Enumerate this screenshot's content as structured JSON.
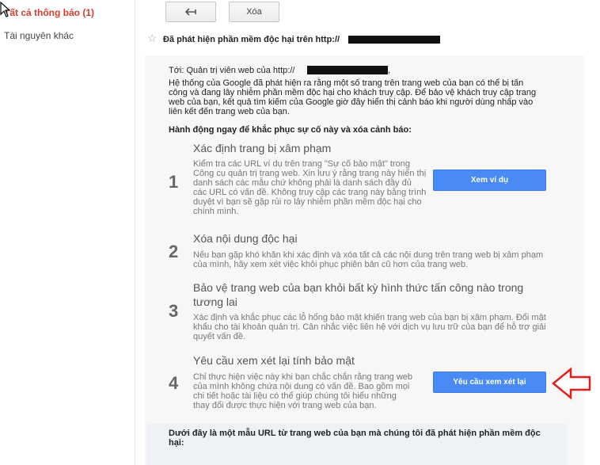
{
  "sidebar": {
    "items": [
      {
        "label": "Tất cả thông báo (1)"
      },
      {
        "label": "Tài nguyên khác"
      }
    ]
  },
  "toolbar": {
    "back_icon": "back-arrow-icon",
    "delete_label": "Xóa"
  },
  "message": {
    "subject": "Đã phát hiện phần mềm độc hại trên http://",
    "to_line": "Tới: Quản trị viên web của http://",
    "to_suffix": ",",
    "intro": "Hệ thống của Google đã phát hiện ra rằng một số trang trên trang web của bạn có thể bị tấn công và đang lây nhiễm phần mềm độc hại cho khách truy cập. Để bảo vệ khách truy cập trang web của bạn, kết quả tìm kiếm của Google giờ đây hiển thị cảnh báo khi người dùng nhấp vào liên kết đến trang web của bạn.",
    "action_heading": "Hành động ngay để khắc phục sự cố này và xóa cảnh báo:",
    "steps": [
      {
        "number": "1",
        "title": "Xác định trang bị xâm phạm",
        "description": "Kiểm tra các URL ví dụ trên trang \"Sự cố bảo mật\" trong Công cụ quản trị trang web. Xin lưu ý rằng trang này hiển thị danh sách các mẫu chứ không phải là danh sách đầy đủ các URL có vấn đề. Không truy cập các trang này bằng trình duyệt vì bạn sẽ gặp rủi ro lây nhiễm phần mềm độc hại cho chính mình.",
        "button": "Xem ví dụ"
      },
      {
        "number": "2",
        "title": "Xóa nội dung độc hại",
        "description": "Nếu bạn gặp khó khăn khi xác định và xóa tất cả các nội dung trên trang web bị xâm phạm của mình, hãy xem xét việc khôi phục phiên bản cũ hơn của trang web."
      },
      {
        "number": "3",
        "title": "Bảo vệ trang web của bạn khỏi bất kỳ hình thức tấn công nào trong tương lai",
        "description": "Xác định và khắc phục các lỗ hổng bảo mật khiến trang web của bạn bị xâm phạm. Đổi mật khẩu cho tài khoản quản trị. Cân nhắc việc liên hệ với dịch vụ lưu trữ của bạn để hỗ trợ giải quyết vấn đề."
      },
      {
        "number": "4",
        "title": "Yêu cầu xem xét lại tính bảo mật",
        "description": "Chỉ thực hiện việc này khi bạn chắc chắn rằng trang web của mình không chứa nội dung có vấn đề. Bao gồm mọi chi tiết hoặc tài liệu có thể giúp chúng tôi hiểu những thay đổi được thực hiện với trang web của bạn.",
        "button": "Yêu cầu xem xét lại"
      }
    ],
    "sample_heading": "Dưới đây là một mẫu URL từ trang web của bạn mà chúng tôi đã phát hiện phần mềm độc hại:"
  },
  "colors": {
    "accent_red": "#d23f31",
    "button_blue": "#4a8af4",
    "arrow_red": "#e02020"
  }
}
